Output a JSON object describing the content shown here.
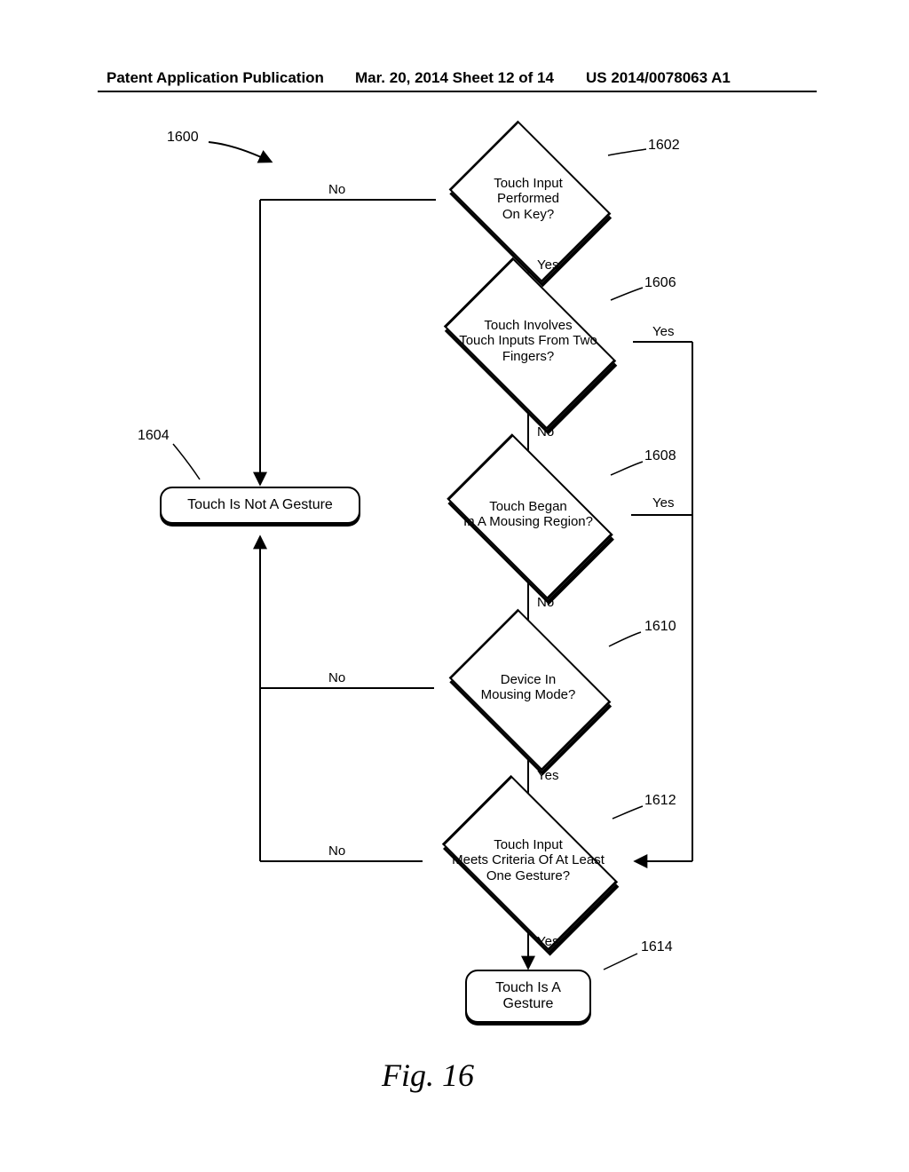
{
  "header": {
    "left": "Patent Application Publication",
    "mid": "Mar. 20, 2014  Sheet 12 of 14",
    "right": "US 2014/0078063 A1"
  },
  "refs": {
    "n1600": "1600",
    "n1602": "1602",
    "n1604": "1604",
    "n1606": "1606",
    "n1608": "1608",
    "n1610": "1610",
    "n1612": "1612",
    "n1614": "1614"
  },
  "nodes": {
    "d1602": {
      "l1": "Touch Input",
      "l2": "Performed",
      "l3": "On Key?"
    },
    "d1606": {
      "l1": "Touch Involves",
      "l2": "Touch Inputs From Two",
      "l3": "Fingers?"
    },
    "d1608": {
      "l1": "Touch Began",
      "l2": "In A Mousing Region?"
    },
    "d1610": {
      "l1": "Device In",
      "l2": "Mousing Mode?"
    },
    "d1612": {
      "l1": "Touch Input",
      "l2": "Meets Criteria Of At Least",
      "l3": "One Gesture?"
    },
    "b1604": "Touch Is Not A Gesture",
    "b1614_l1": "Touch Is A",
    "b1614_l2": "Gesture"
  },
  "edges": {
    "no": "No",
    "yes": "Yes"
  },
  "figure_caption": "Fig. 16"
}
